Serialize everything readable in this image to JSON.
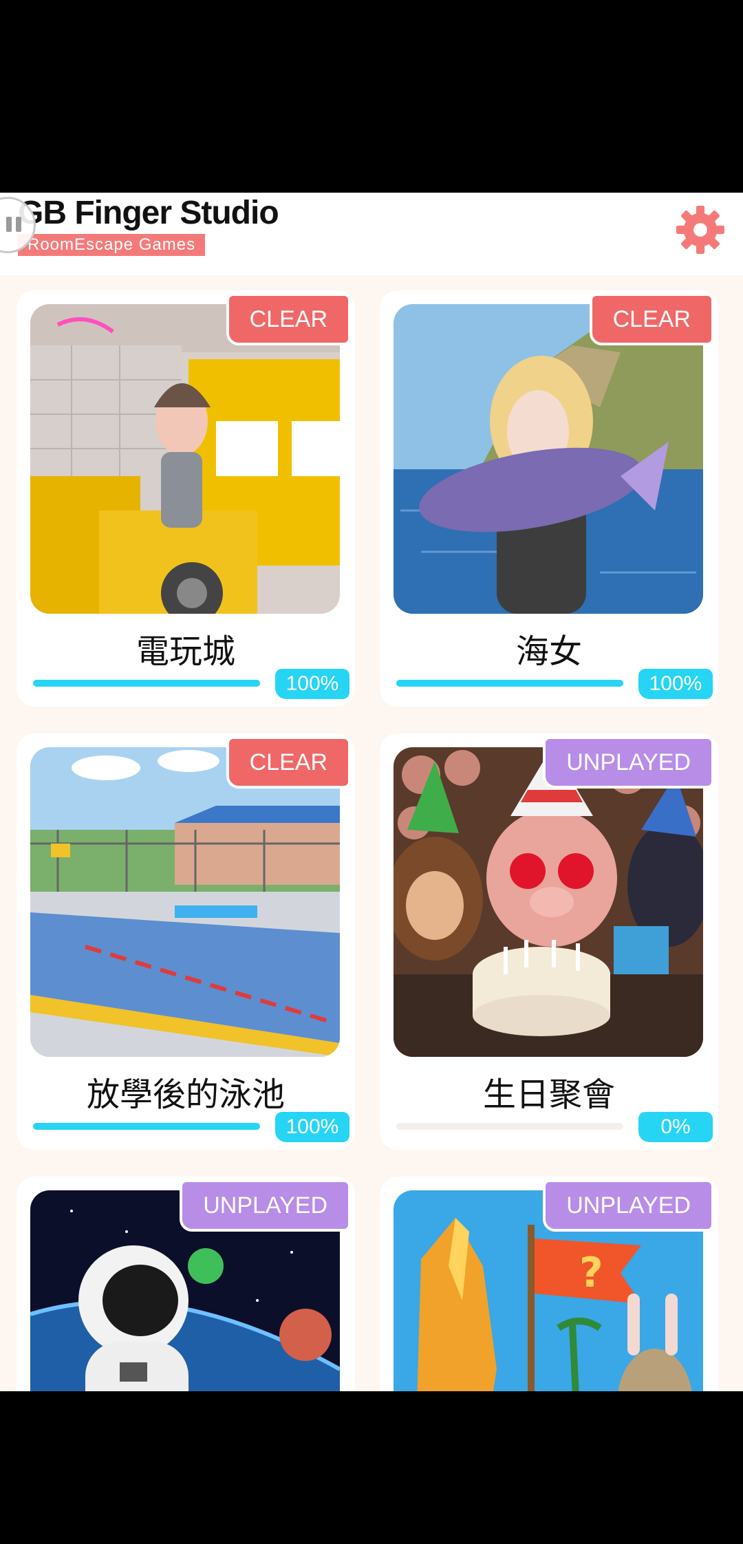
{
  "header": {
    "brand_title": "GB Finger Studio",
    "brand_subtitle": "RoomEscape Games",
    "accent_color": "#f47a7a"
  },
  "games": [
    {
      "title": "電玩城",
      "status": "CLEAR",
      "progress_label": "100%",
      "progress": 1.0
    },
    {
      "title": "海女",
      "status": "CLEAR",
      "progress_label": "100%",
      "progress": 1.0
    },
    {
      "title": "放學後的泳池",
      "status": "CLEAR",
      "progress_label": "100%",
      "progress": 1.0
    },
    {
      "title": "生日聚會",
      "status": "UNPLAYED",
      "progress_label": "0%",
      "progress": 0.0
    },
    {
      "title": "",
      "status": "UNPLAYED"
    },
    {
      "title": "",
      "status": "UNPLAYED"
    }
  ],
  "colors": {
    "clear": "#f06767",
    "unplayed": "#b88de8",
    "progress": "#26d4f4",
    "background": "#fdf6f1"
  },
  "icons": [
    "sound-toggle-icon",
    "settings-gear-icon"
  ]
}
